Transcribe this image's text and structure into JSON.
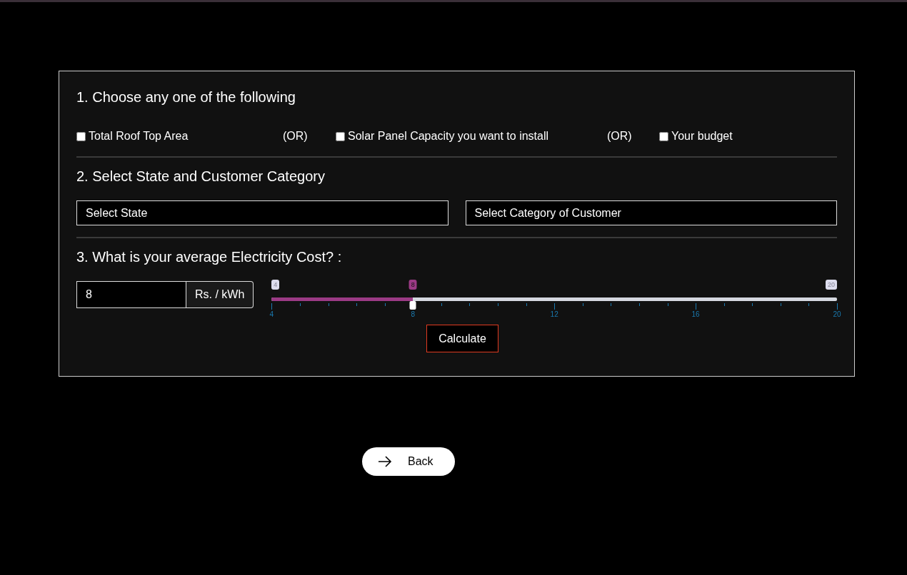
{
  "sections": [
    {
      "title": "1. Choose any one of the following"
    },
    {
      "title": "2. Select State and Customer Category"
    },
    {
      "title": "3. What is your average Electricity Cost? :"
    }
  ],
  "choices": [
    {
      "kind": "checkbox",
      "label": "Total Roof Top Area",
      "checked": false
    },
    {
      "kind": "separator",
      "label": "(OR)"
    },
    {
      "kind": "checkbox",
      "label": "Solar Panel Capacity you want to install",
      "checked": false
    },
    {
      "kind": "separator",
      "label": "(OR)"
    },
    {
      "kind": "checkbox",
      "label": "Your budget",
      "checked": false
    }
  ],
  "selects": [
    {
      "placeholder": "Select State"
    },
    {
      "placeholder": "Select Category of Customer"
    }
  ],
  "cost": {
    "value": "8",
    "unit": "Rs. / kWh"
  },
  "slider": {
    "min_label": "4",
    "value_label": "8",
    "max_label": "20",
    "level": 0.25,
    "tick_labels": [
      "4",
      "8",
      "12",
      "16",
      "20"
    ]
  },
  "calculate_button": "Calculate",
  "back_button": "Back"
}
